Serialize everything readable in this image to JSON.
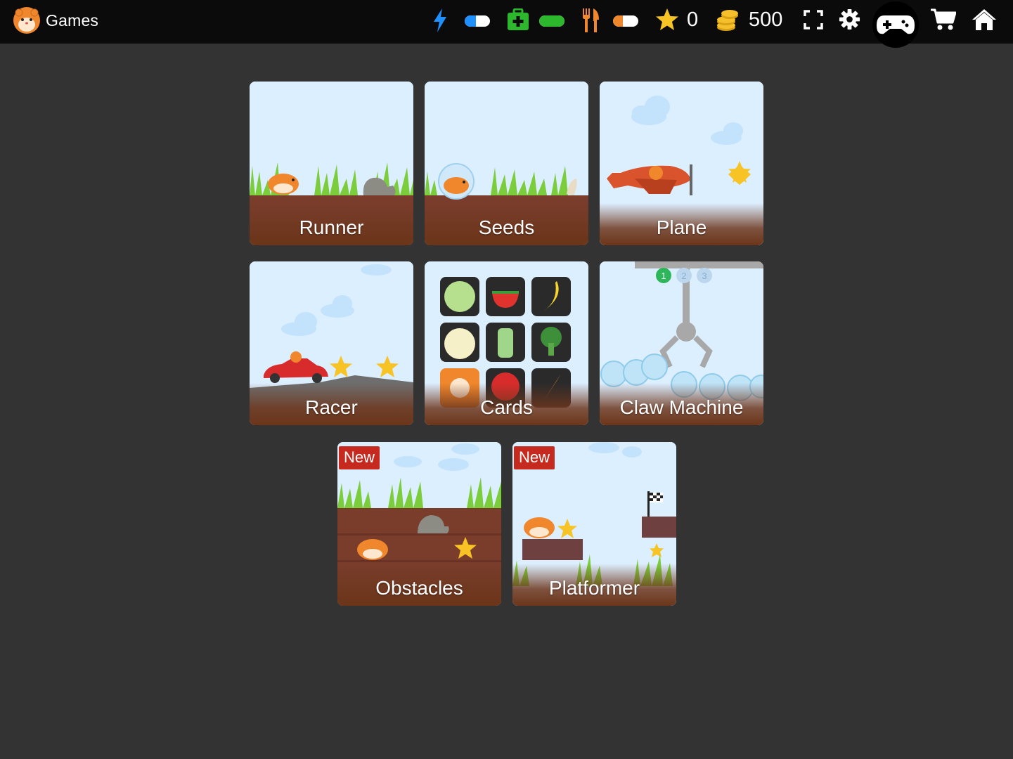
{
  "header": {
    "title": "Games",
    "logo_icon": "hamster-face-icon",
    "stats": {
      "energy": {
        "icon": "lightning-icon",
        "level": 0.45,
        "color": "#1e90ff"
      },
      "health": {
        "icon": "first-aid-kit-icon",
        "level": 1.0,
        "color": "#2db72d"
      },
      "food": {
        "icon": "fork-knife-icon",
        "level": 0.4,
        "color": "#f0872c"
      }
    },
    "stars": "0",
    "coins": "500",
    "icons": {
      "fullscreen": "fullscreen-icon",
      "settings": "gear-icon",
      "games": "gamepad-icon",
      "shop": "cart-icon",
      "home": "home-icon"
    }
  },
  "games": [
    {
      "label": "Runner"
    },
    {
      "label": "Seeds"
    },
    {
      "label": "Plane"
    },
    {
      "label": "Racer"
    },
    {
      "label": "Cards"
    },
    {
      "label": "Claw Machine"
    },
    {
      "label": "Obstacles",
      "badge": "New"
    },
    {
      "label": "Platformer",
      "badge": "New"
    }
  ],
  "claw_counters": [
    "1",
    "2",
    "3"
  ]
}
